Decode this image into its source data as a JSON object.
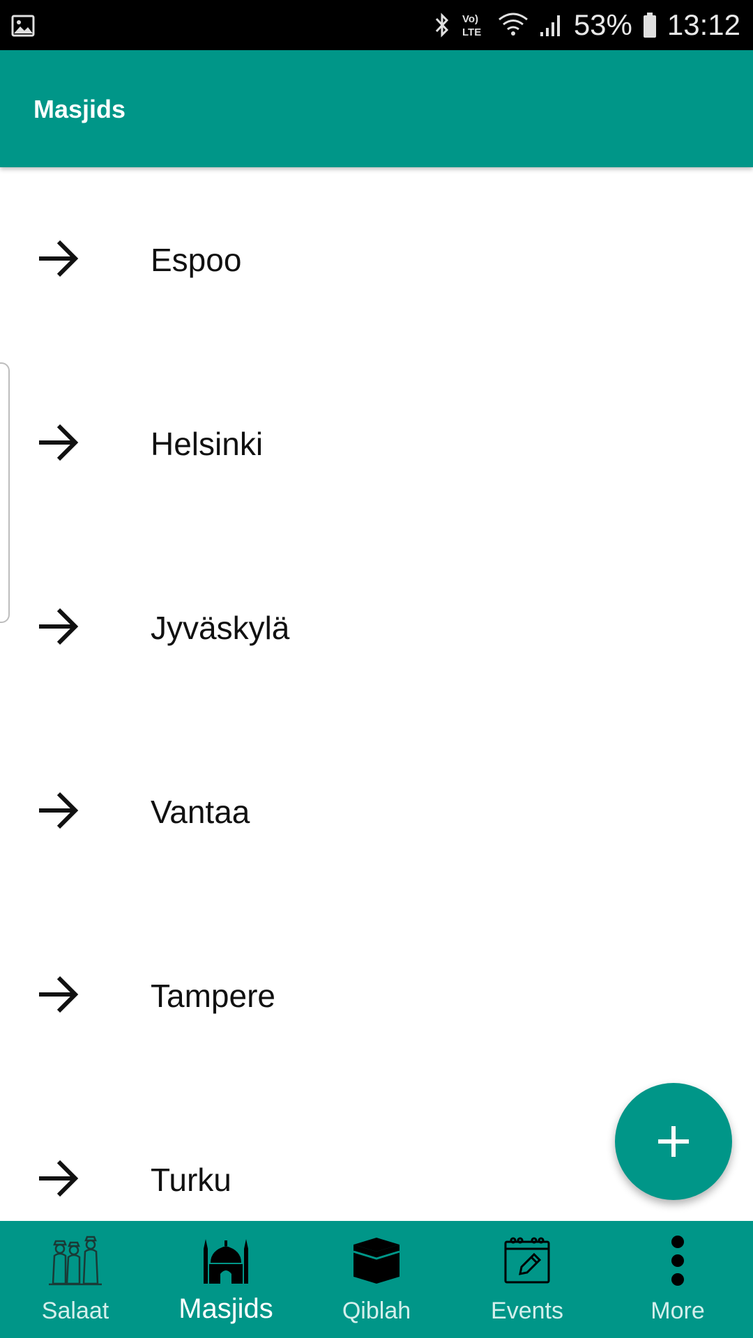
{
  "status_bar": {
    "battery": "53%",
    "time": "13:12",
    "network": "LTE"
  },
  "app_bar": {
    "title": "Masjids"
  },
  "list": {
    "items": [
      {
        "label": "Espoo"
      },
      {
        "label": "Helsinki"
      },
      {
        "label": "Jyväskylä"
      },
      {
        "label": "Vantaa"
      },
      {
        "label": "Tampere"
      },
      {
        "label": "Turku"
      }
    ]
  },
  "fab": {
    "icon": "plus-icon"
  },
  "bottom_nav": {
    "items": [
      {
        "label": "Salaat",
        "icon": "praying-people-icon"
      },
      {
        "label": "Masjids",
        "icon": "mosque-icon"
      },
      {
        "label": "Qiblah",
        "icon": "kaaba-icon"
      },
      {
        "label": "Events",
        "icon": "calendar-icon"
      },
      {
        "label": "More",
        "icon": "more-vertical-icon"
      }
    ],
    "active": "Masjids"
  },
  "colors": {
    "primary": "#009688",
    "status_bar": "#000000",
    "text": "#111111"
  }
}
